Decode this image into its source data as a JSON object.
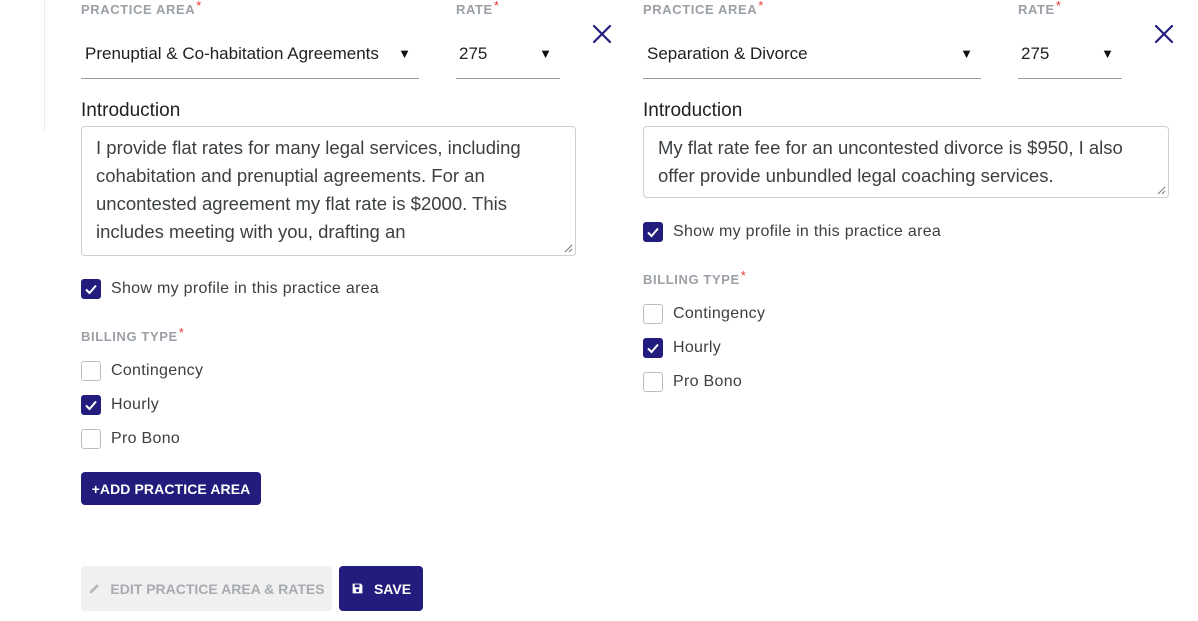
{
  "required_mark": "*",
  "practice_areas": [
    {
      "practice_area_label": "PRACTICE AREA",
      "practice_area_value": "Prenuptial & Co-habitation Agreements",
      "rate_label": "RATE",
      "rate_value": "275",
      "introduction_label": "Introduction",
      "introduction_text": "I provide flat rates for many legal services, including cohabitation and prenuptial agreements. For an uncontested agreement my flat rate is $2000. This includes meeting with you, drafting an",
      "show_profile_label": "Show my profile in this practice area",
      "show_profile_checked": true,
      "billing_type_label": "BILLING TYPE",
      "billing_types": [
        {
          "label": "Contingency",
          "checked": false
        },
        {
          "label": "Hourly",
          "checked": true
        },
        {
          "label": "Pro Bono",
          "checked": false
        }
      ]
    },
    {
      "practice_area_label": "PRACTICE AREA",
      "practice_area_value": "Separation & Divorce",
      "rate_label": "RATE",
      "rate_value": "275",
      "introduction_label": "Introduction",
      "introduction_text": "My flat rate fee for an uncontested divorce is $950, I also offer provide unbundled legal coaching services.",
      "show_profile_label": "Show my profile in this practice area",
      "show_profile_checked": true,
      "billing_type_label": "BILLING TYPE",
      "billing_types": [
        {
          "label": "Contingency",
          "checked": false
        },
        {
          "label": "Hourly",
          "checked": true
        },
        {
          "label": "Pro Bono",
          "checked": false
        }
      ]
    }
  ],
  "buttons": {
    "add_practice_area": "+ADD PRACTICE AREA",
    "edit_practice_area_rates": "EDIT PRACTICE AREA & RATES",
    "save": "SAVE"
  },
  "icons": {
    "dropdown": "caret-down-icon",
    "remove": "close-icon",
    "edit": "pencil-icon",
    "save": "floppy-disk-icon",
    "checkbox": "check-icon"
  },
  "colors": {
    "primary": "#221d7c",
    "required": "#e53935",
    "muted_label": "#9aa0a6",
    "disabled_bg": "#f0f0f0",
    "disabled_text": "#a7abb0"
  }
}
